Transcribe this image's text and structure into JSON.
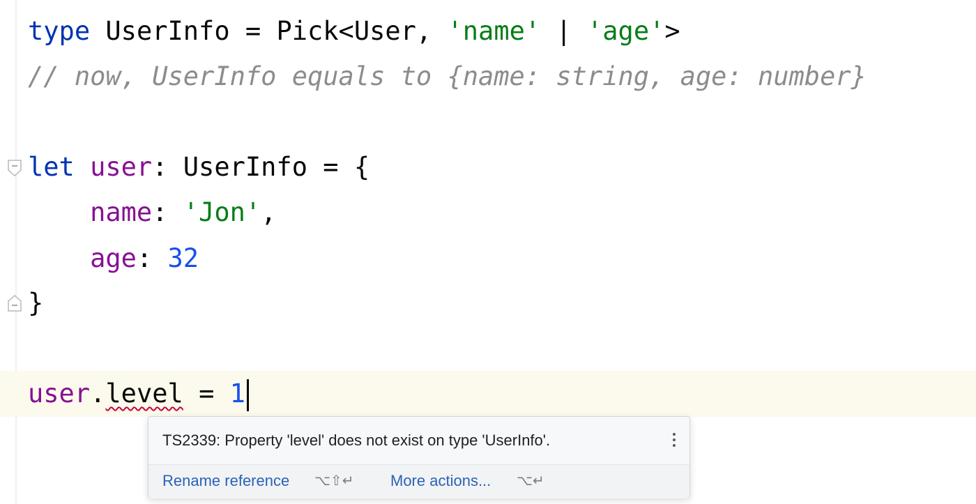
{
  "editor": {
    "lines": {
      "l1": {
        "kw": "type",
        "name": "UserInfo",
        "eq": "=",
        "pick": "Pick<User,",
        "s1": "'name'",
        "pipe": "|",
        "s2": "'age'",
        "close": ">"
      },
      "l2": {
        "comment": "// now, UserInfo equals to {name: string, age: number}"
      },
      "l3": {
        "kw": "let",
        "var": "user",
        "colon": ":",
        "type": "UserInfo",
        "eq": "=",
        "brace": "{"
      },
      "l4": {
        "prop": "name",
        "colon": ":",
        "str": "'Jon'",
        "comma": ","
      },
      "l5": {
        "prop": "age",
        "colon": ":",
        "num": "32"
      },
      "l6": {
        "brace": "}"
      },
      "l7": {
        "var": "user",
        "dot": ".",
        "prop": "level",
        "eq": "=",
        "num": "1"
      }
    }
  },
  "tooltip": {
    "message": "TS2339: Property 'level' does not exist on type 'UserInfo'.",
    "actions": [
      {
        "label": "Rename reference",
        "shortcut": "⌥⇧↵"
      },
      {
        "label": "More actions...",
        "shortcut": "⌥↵"
      }
    ]
  },
  "colors": {
    "keyword": "#0033b3",
    "variable": "#871094",
    "string": "#067d17",
    "number": "#1750eb",
    "comment": "#8c8c8c",
    "error_underline": "#c7003f",
    "link": "#2a62b8"
  }
}
